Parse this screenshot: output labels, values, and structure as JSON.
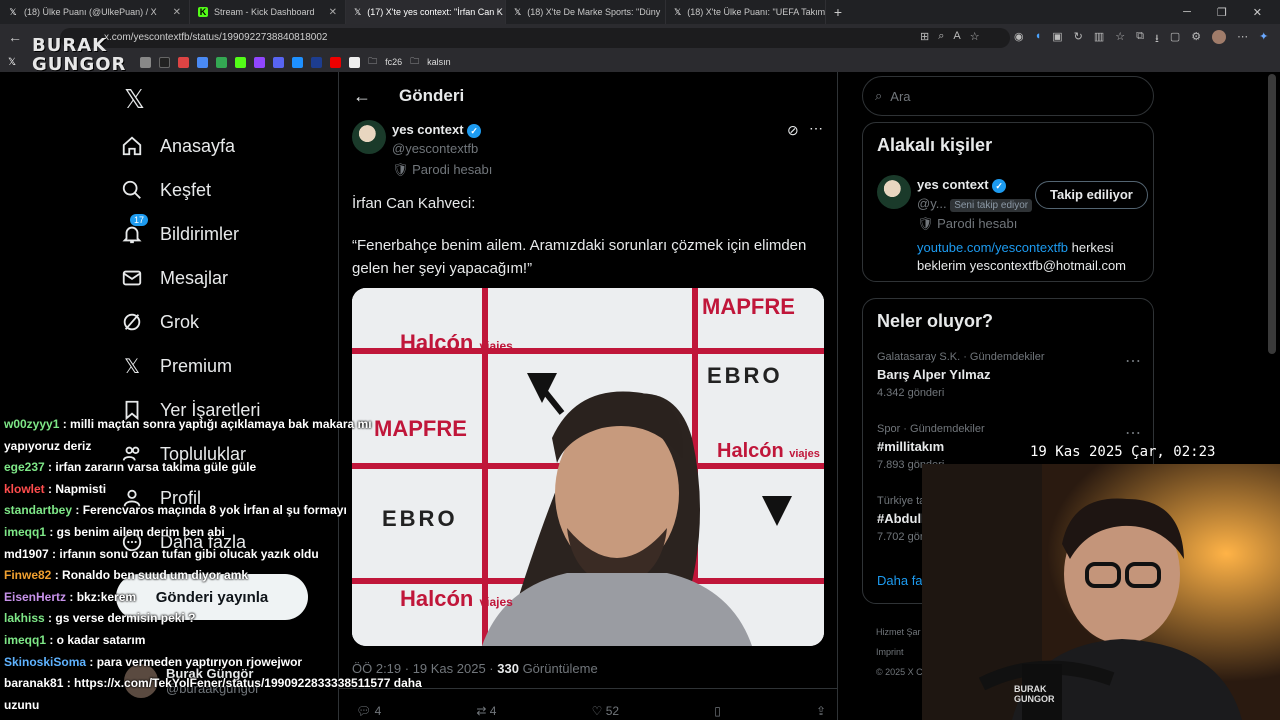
{
  "browser": {
    "tabs": [
      {
        "title": "(18) Ülke Puanı (@UlkePuan) / X",
        "icon": "x-logo"
      },
      {
        "title": "Stream - Kick Dashboard",
        "icon": "kick-logo"
      },
      {
        "title": "(17) X'te yes context: \"İrfan Can K",
        "icon": "x-logo",
        "active": true
      },
      {
        "title": "(18) X'te De Marke Sports: \"Düny",
        "icon": "x-logo"
      },
      {
        "title": "(18) X'te Ülke Puanı: \"UEFA Takım",
        "icon": "x-logo"
      }
    ],
    "url": "x.com/yescontextfb/status/1990922738840818002",
    "bookmarks": [
      "fc26",
      "kalsın"
    ]
  },
  "streamer_logo": {
    "line1": "BURAK",
    "line2": "GUNGOR"
  },
  "nav": {
    "items": [
      {
        "label": "Anasayfa",
        "icon": "home-icon"
      },
      {
        "label": "Keşfet",
        "icon": "search-icon"
      },
      {
        "label": "Bildirimler",
        "icon": "bell-icon",
        "badge": "17"
      },
      {
        "label": "Mesajlar",
        "icon": "mail-icon"
      },
      {
        "label": "Grok",
        "icon": "grok-icon"
      },
      {
        "label": "Premium",
        "icon": "x-icon"
      },
      {
        "label": "Yer İşaretleri",
        "icon": "bookmark-icon"
      },
      {
        "label": "Topluluklar",
        "icon": "people-icon"
      },
      {
        "label": "Profil",
        "icon": "user-icon"
      },
      {
        "label": "Daha fazla",
        "icon": "more-icon"
      }
    ],
    "post_button": "Gönderi yayınla",
    "account_name": "Burak Güngör",
    "account_handle": "@buraakgungor"
  },
  "post": {
    "header": "Gönderi",
    "author_name": "yes context",
    "author_handle": "@yescontextfb",
    "parody_label": "Parodi hesabı",
    "text_line1": "İrfan Can Kahveci:",
    "text_line2": "“Fenerbahçe benim ailem. Aramızdaki sorunları çözmek için elimden gelen her şeyi yapacağım!”",
    "meta_time": "ÖÖ 2:19 · 19 Kas 2025 · ",
    "views": "330",
    "views_label": " Görüntüleme",
    "actions": {
      "replies": "4",
      "reposts": "4",
      "likes": "52"
    },
    "image_text": {
      "sponsor1": "Halcón",
      "sponsor1b": "viajes",
      "sponsor2": "MAPFRE",
      "sponsor3": "EBRO"
    }
  },
  "right": {
    "search_placeholder": "Ara",
    "related_title": "Alakalı kişiler",
    "related": {
      "name": "yes context",
      "handle": "@y...",
      "follows_you": "Seni takip ediyor",
      "parody": "Parodi hesabı",
      "follow_button": "Takip ediliyor",
      "bio_link": "youtube.com/yescontextfb",
      "bio_rest": " herkesi beklerim yescontextfb@hotmail.com"
    },
    "trends_title": "Neler oluyor?",
    "trends": [
      {
        "context": "Galatasaray S.K. · Gündemdekiler",
        "name": "Barış Alper Yılmaz",
        "count": "4.342 gönderi"
      },
      {
        "context": "Spor · Gündemdekiler",
        "name": "#millitakım",
        "count": "7.893 gönderi"
      },
      {
        "context": "Türkiye ta",
        "name": "#Abdull",
        "count": "7.702 gön"
      }
    ],
    "show_more": "Daha faz",
    "footer": [
      "Hizmet Şar",
      "Imprint",
      "© 2025 X C"
    ]
  },
  "overlay": {
    "clock": "19 Kas 2025 Çar, 02:23"
  },
  "chat": [
    {
      "user": "w00zyyy1",
      "color": "#7ee787",
      "msg": ": milli maçtan sonra yaptığı açıklamaya bak makara mı yapıyoruz deriz"
    },
    {
      "user": "ege237",
      "color": "#7ee787",
      "msg": ": irfan zararın varsa takıma güle güle"
    },
    {
      "user": "klowlet",
      "color": "#ff4d4d",
      "msg": ": Napmisti"
    },
    {
      "user": "standartbey",
      "color": "#7ee787",
      "msg": ": Ferencvaros maçında 8 yok İrfan al şu formayı"
    },
    {
      "user": "imeqq1",
      "color": "#7ee787",
      "msg": ": gs benim ailem derim ben abi"
    },
    {
      "user": "md1907",
      "color": "#ffffff",
      "msg": ": irfanın sonu ozan tufan gibi olucak yazık oldu"
    },
    {
      "user": "Finwe82",
      "color": "#f0a030",
      "msg": ": Ronaldo ben suud um diyor amk"
    },
    {
      "user": "EisenHertz",
      "color": "#c792ea",
      "msg": ": bkz:kerem"
    },
    {
      "user": "lakhiss",
      "color": "#7ee787",
      "msg": ": gs verse dermisin peki ?"
    },
    {
      "user": "imeqq1",
      "color": "#7ee787",
      "msg": ": o kadar satarım"
    },
    {
      "user": "SkinoskiSoma",
      "color": "#5fb3ff",
      "msg": ": para vermeden yaptırıyon rjowejwor"
    },
    {
      "user": "baranak81",
      "color": "#ffffff",
      "msg": ": https://x.com/TekYolFener/status/1990922833338511577 daha uzunu"
    }
  ]
}
